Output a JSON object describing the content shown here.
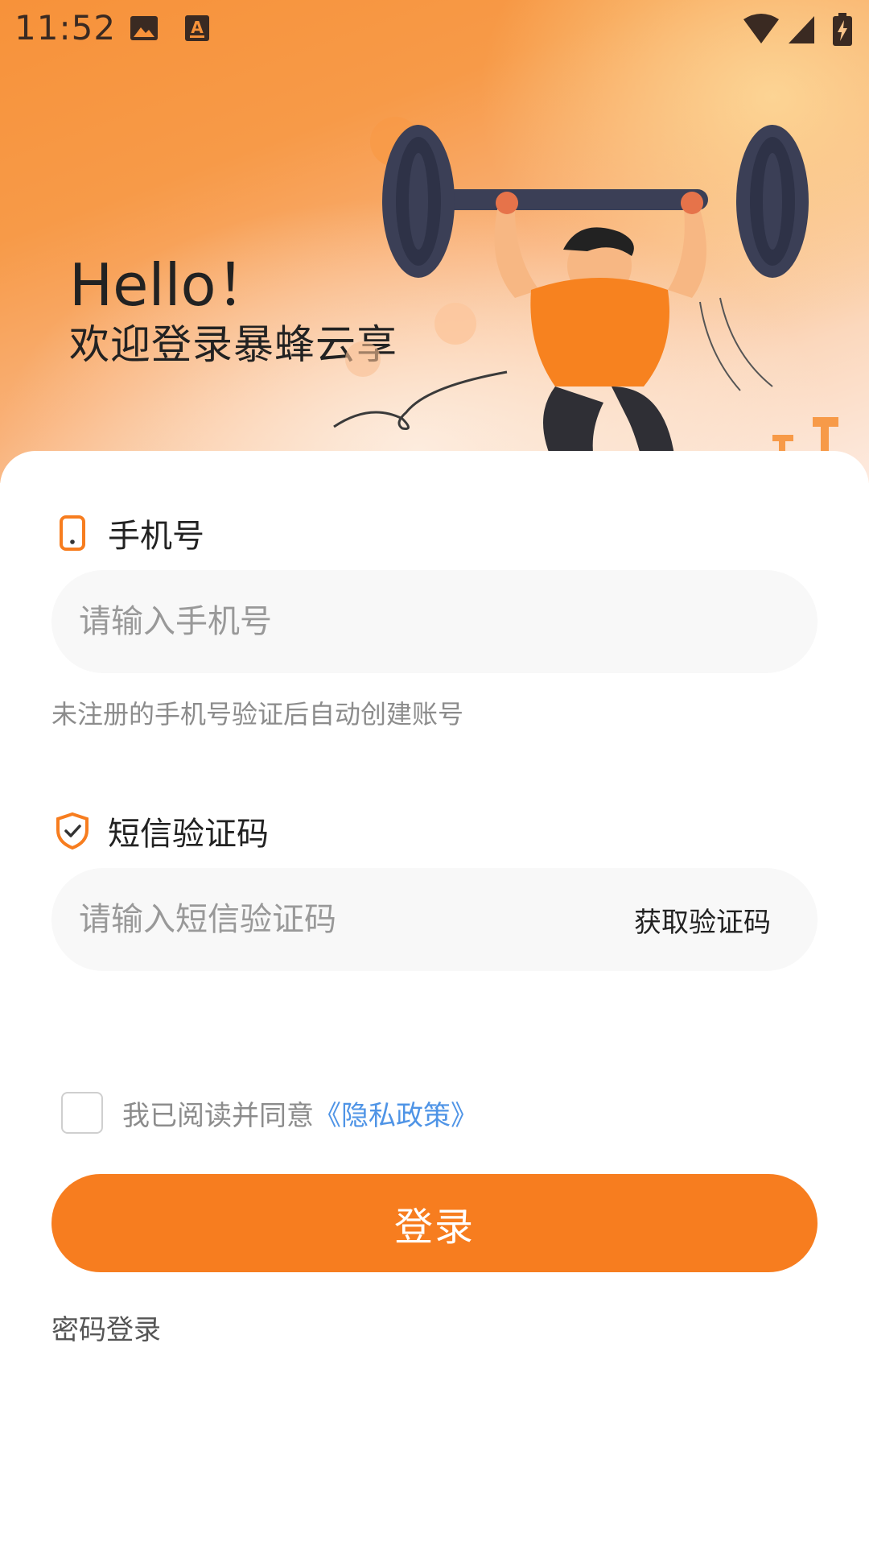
{
  "status_bar": {
    "time": "11:52",
    "icons": [
      "image-notification-icon",
      "text-notification-icon",
      "wifi-icon",
      "cellular-signal-icon",
      "battery-charging-icon"
    ]
  },
  "header": {
    "hello": "Hello！",
    "welcome": "欢迎登录暴蜂云享",
    "illustration": "weightlifter-illustration"
  },
  "phone": {
    "label": "手机号",
    "icon": "phone-icon",
    "placeholder": "请输入手机号",
    "value": "",
    "hint": "未注册的手机号验证后自动创建账号"
  },
  "sms": {
    "label": "短信验证码",
    "icon": "shield-check-icon",
    "placeholder": "请输入短信验证码",
    "value": "",
    "get_code_label": "获取验证码"
  },
  "agreement": {
    "checked": false,
    "text": "我已阅读并同意",
    "policy_link": "《隐私政策》"
  },
  "login_button": "登录",
  "password_login": "密码登录",
  "colors": {
    "accent": "#f77d1f",
    "link": "#4f94e6",
    "hint": "#8c8c8c",
    "input_bg": "#f8f8f8"
  }
}
